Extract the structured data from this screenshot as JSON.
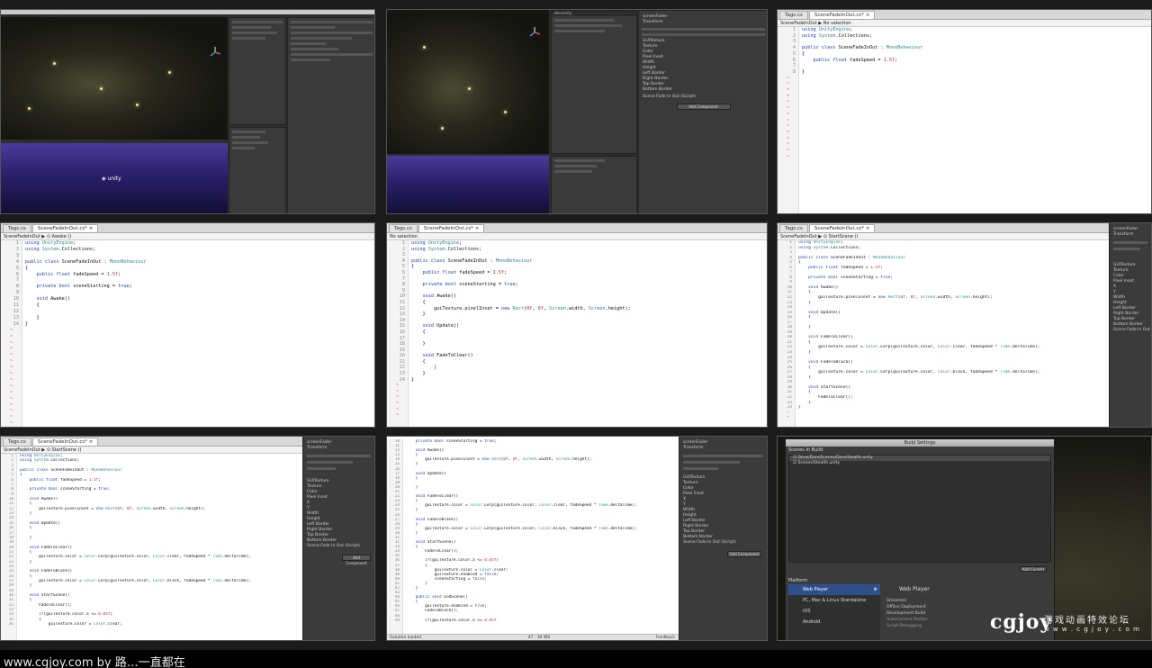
{
  "editor": {
    "tabs": {
      "tags": "Tags.cs",
      "fader": "SceneFadeInOut.cs*",
      "close": "×"
    },
    "crumbs": {
      "none": "No selection",
      "awake": "SceneFadeInOut ▶ ⊙ Awake ()",
      "start": "SceneFadeInOut ▶ ⊙ StartScene ()",
      "class": "SceneFadeInOut ▶ No selection"
    },
    "status": {
      "left": "Solution loaded.",
      "pos": "47 : 30  INS",
      "right": "Feedback"
    },
    "snippets": {
      "s1": [
        "using UnityEngine;",
        "using System.Collections;",
        "",
        "public class SceneFadeInOut : MonoBehaviour",
        "{",
        "    public float fadeSpeed = 1.5f;",
        "",
        "}"
      ],
      "s2": [
        "using UnityEngine;",
        "using System.Collections;",
        "",
        "public class SceneFadeInOut : MonoBehaviour",
        "{",
        "    public float fadeSpeed = 1.5f;",
        "",
        "    private bool sceneStarting = true;",
        "",
        "    void Awake()",
        "    {",
        "",
        "    }",
        "}"
      ],
      "s3": [
        "using UnityEngine;",
        "using System.Collections;",
        "",
        "public class SceneFadeInOut : MonoBehaviour",
        "{",
        "    public float fadeSpeed = 1.5f;",
        "",
        "    private bool sceneStarting = true;",
        "",
        "    void Awake()",
        "    {",
        "        guiTexture.pixelInset = new Rect(0f, 0f, Screen.width, Screen.height);",
        "    }",
        "",
        "    void Update()",
        "    {",
        "",
        "    }",
        "",
        "    void FadeToClear()",
        "    {",
        "        |",
        "    }",
        "}"
      ],
      "s4": [
        "using UnityEngine;",
        "using System.Collections;",
        "",
        "public class SceneFadeInOut : MonoBehaviour",
        "{",
        "    public float fadeSpeed = 1.5f;",
        "",
        "    private bool sceneStarting = true;",
        "",
        "    void Awake()",
        "    {",
        "        guiTexture.pixelInset = new Rect(0f, 0f, Screen.width, Screen.height);",
        "    }",
        "",
        "    void Update()",
        "    {",
        "",
        "    }",
        "",
        "    void FadeToClear()",
        "    {",
        "        guiTexture.color = Color.Lerp(guiTexture.color, Color.clear, fadeSpeed * Time.deltaTime);",
        "    }",
        "",
        "    void FadeToBlack()",
        "    {",
        "        guiTexture.color = Color.Lerp(guiTexture.color, Color.black, fadeSpeed * Time.deltaTime);",
        "    }",
        "",
        "    void StartScene()",
        "    {",
        "        FadeToClear();",
        "    }",
        "}"
      ],
      "s5": [
        "using UnityEngine;",
        "using System.Collections;",
        "",
        "public class SceneFadeInOut : MonoBehaviour",
        "{",
        "    public float fadeSpeed = 1.5f;",
        "",
        "    private bool sceneStarting = true;",
        "",
        "    void Awake()",
        "    {",
        "        guiTexture.pixelInset = new Rect(0f, 0f, Screen.width, Screen.height);",
        "    }",
        "",
        "    void Update()",
        "    {",
        "",
        "    }",
        "",
        "    void FadeToClear()",
        "    {",
        "        guiTexture.color = Color.Lerp(guiTexture.color, Color.clear, fadeSpeed * Time.deltaTime);",
        "    }",
        "",
        "    void FadeToBlack()",
        "    {",
        "        guiTexture.color = Color.Lerp(guiTexture.color, Color.black, fadeSpeed * Time.deltaTime);",
        "    }",
        "",
        "    void StartScene()",
        "    {",
        "        FadeToClear();",
        "",
        "        if(guiTexture.color.a <= 0.05f)",
        "        {",
        "            guiTexture.color = Color.clear;"
      ],
      "s6": [
        "    private bool sceneStarting = true;",
        "",
        "    void Awake()",
        "    {",
        "        guiTexture.pixelInset = new Rect(0f, 0f, Screen.width, Screen.height);",
        "    }",
        "",
        "    void Update()",
        "    {",
        "",
        "    }",
        "",
        "    void FadeToClear()",
        "    {",
        "        guiTexture.color = Color.Lerp(guiTexture.color, Color.clear, fadeSpeed * Time.deltaTime);",
        "    }",
        "",
        "    void FadeToBlack()",
        "    {",
        "        guiTexture.color = Color.Lerp(guiTexture.color, Color.black, fadeSpeed * Time.deltaTime);",
        "    }",
        "",
        "    void StartScene()",
        "    {",
        "        FadeToClear();",
        "",
        "        if(guiTexture.color.a <= 0.05f)",
        "        {",
        "            guiTexture.color = Color.clear;",
        "            guiTexture.enabled = false;",
        "            sceneStarting = false;",
        "        }",
        "    }",
        "",
        "    public void EndScene()",
        "    {",
        "        guiTexture.enabled = true;",
        "        FadeToBlack();",
        "",
        "        if(guiTexture.color.a >= 0.95f"
      ]
    }
  },
  "inspector": {
    "labels": [
      "Texture",
      "Color",
      "Pixel Inset",
      "X",
      "Y",
      "Width",
      "Height",
      "Left Border",
      "Right Border",
      "Top Border",
      "Bottom Border"
    ],
    "component": "Scene Fade In Out (Script)",
    "add_component": "Add Component",
    "gui_texture": "GUITexture",
    "transform": "Transform",
    "fader_object": "screenFader"
  },
  "unity": {
    "unity_logo_text": "unity"
  },
  "build": {
    "title": "Build Settings",
    "scenes_header": "Scenes In Build",
    "scenes": [
      "Done/DoneScenes/DoneStealth.unity",
      "Scenes/Stealth.unity"
    ],
    "add_current": "Add Current",
    "platform_header": "Platform",
    "platforms": [
      "Web Player",
      "PC, Mac & Linux Standalone",
      "iOS",
      "Android"
    ],
    "selected_platform": "Web Player",
    "options": [
      "Streamed",
      "Offline Deployment",
      "Development Build",
      "Autoconnect Profiler",
      "Script Debugging"
    ]
  },
  "footer": {
    "text": "www.cgjoy.com by 路…一直都在"
  },
  "watermark": {
    "logo": "cgjoy",
    "cn": "游戏动画特效论坛",
    "url": "w w w . c g j o y . c o m"
  },
  "colors": {
    "keyword": "#1f3fbf",
    "type": "#2b8a9a",
    "number": "#c42a2a",
    "tilde": "#cc3333",
    "unity_bg": "#2e2e2e",
    "platform_selected": "#2d4f8e"
  }
}
